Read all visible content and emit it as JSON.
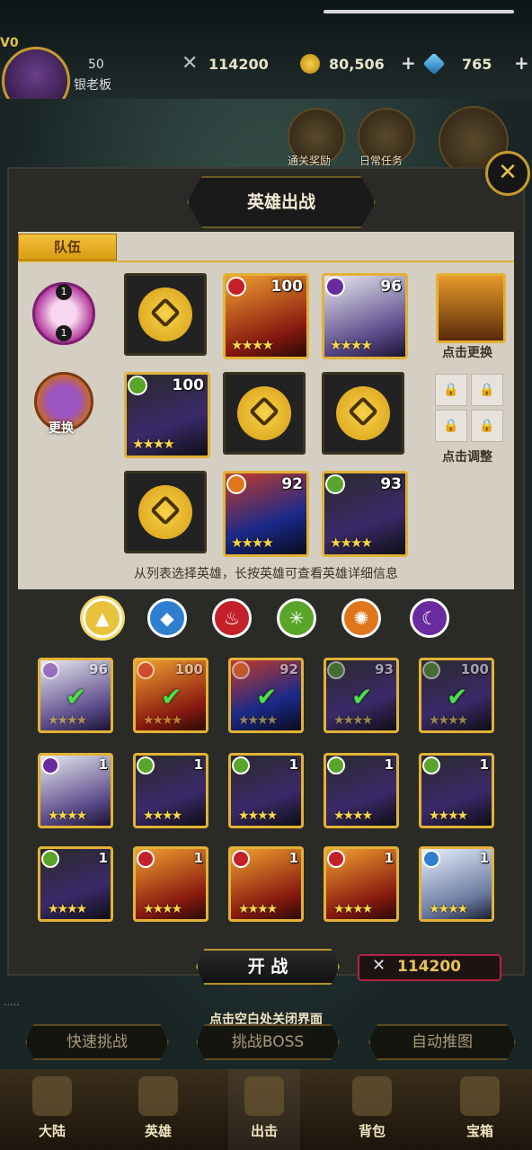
{
  "header": {
    "vip": "V0",
    "level": "50",
    "player_name": "银老板",
    "power": "114200",
    "gold": "80,506",
    "gems": "765"
  },
  "top_icons": {
    "clear_reward": "通关奖励",
    "daily_task": "日常任务"
  },
  "panel": {
    "title": "英雄出战",
    "team_tab": "队伍",
    "change_label": "更换",
    "click_change": "点击更换",
    "click_adjust": "点击调整",
    "hint": "从列表选择英雄，长按英雄可查看英雄详细信息",
    "badge_top": "1",
    "badge_bottom": "1"
  },
  "team_slots": [
    {
      "type": "empty"
    },
    {
      "type": "hero",
      "level": "100",
      "element": "fire",
      "stars": "★★★★"
    },
    {
      "type": "hero",
      "level": "96",
      "element": "moon",
      "stars": "★★★★"
    },
    {
      "type": "hero",
      "level": "100",
      "element": "wind",
      "stars": "★★★★"
    },
    {
      "type": "empty"
    },
    {
      "type": "empty"
    },
    {
      "type": "empty"
    },
    {
      "type": "hero",
      "level": "92",
      "element": "sun",
      "stars": "★★★★"
    },
    {
      "type": "hero",
      "level": "93",
      "element": "wind",
      "stars": "★★★★"
    }
  ],
  "elements": [
    {
      "name": "all",
      "color": "#e8c23a",
      "glyph": "▲"
    },
    {
      "name": "water",
      "color": "#2f7fd0",
      "glyph": "◆"
    },
    {
      "name": "fire",
      "color": "#c4202a",
      "glyph": "♨"
    },
    {
      "name": "wind",
      "color": "#59a52a",
      "glyph": "✳"
    },
    {
      "name": "sun",
      "color": "#e0761c",
      "glyph": "✺"
    },
    {
      "name": "moon",
      "color": "#6a2aa0",
      "glyph": "☾"
    }
  ],
  "roster": [
    {
      "level": "96",
      "element": "moon",
      "stars": "★★★★",
      "selected": true
    },
    {
      "level": "100",
      "element": "fire",
      "stars": "★★★★",
      "selected": true
    },
    {
      "level": "92",
      "element": "sun",
      "stars": "★★★★",
      "selected": true
    },
    {
      "level": "93",
      "element": "wind",
      "stars": "★★★★",
      "selected": true
    },
    {
      "level": "100",
      "element": "wind",
      "stars": "★★★★",
      "selected": true
    },
    {
      "level": "1",
      "element": "moon",
      "stars": "★★★★",
      "selected": false
    },
    {
      "level": "1",
      "element": "wind",
      "stars": "★★★★",
      "selected": false
    },
    {
      "level": "1",
      "element": "wind",
      "stars": "★★★★",
      "selected": false
    },
    {
      "level": "1",
      "element": "wind",
      "stars": "★★★★",
      "selected": false
    },
    {
      "level": "1",
      "element": "wind",
      "stars": "★★★★",
      "selected": false
    },
    {
      "level": "1",
      "element": "wind",
      "stars": "★★★★",
      "selected": false
    },
    {
      "level": "1",
      "element": "fire",
      "stars": "★★★★",
      "selected": false
    },
    {
      "level": "1",
      "element": "fire",
      "stars": "★★★★",
      "selected": false
    },
    {
      "level": "1",
      "element": "fire",
      "stars": "★★★★",
      "selected": false
    },
    {
      "level": "1",
      "element": "water",
      "stars": "★★★★",
      "selected": false
    }
  ],
  "bottom": {
    "start_battle": "开 战",
    "team_power": "114200",
    "close_hint": "点击空白处关闭界面",
    "quick_challenge": "快速挑战",
    "challenge_boss": "挑战BOSS",
    "auto_push": "自动推图"
  },
  "nav": [
    {
      "label": "大陆"
    },
    {
      "label": "英雄"
    },
    {
      "label": "出击"
    },
    {
      "label": "背包"
    },
    {
      "label": "宝箱"
    }
  ],
  "colors": {
    "gold_accent": "#e3b235",
    "panel_bg": "#d5cec2",
    "power_red": "#b42242"
  }
}
